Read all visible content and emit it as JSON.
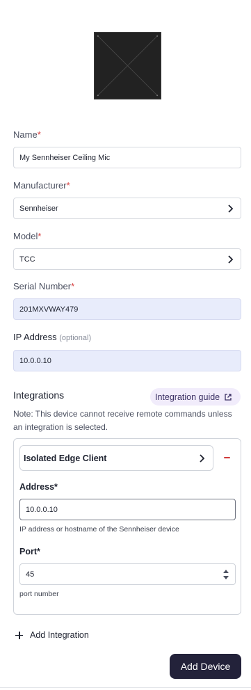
{
  "form": {
    "name": {
      "label": "Name",
      "required_mark": "*",
      "value": "My Sennheiser Ceiling Mic"
    },
    "manufacturer": {
      "label": "Manufacturer",
      "required_mark": "*",
      "value": "Sennheiser",
      "icon": "chevron-right-icon"
    },
    "model": {
      "label": "Model",
      "required_mark": "*",
      "value": "TCC",
      "icon": "chevron-right-icon"
    },
    "serial": {
      "label": "Serial Number",
      "required_mark": "*",
      "value": "201MXVWAY479"
    },
    "ip": {
      "label": "IP Address",
      "optional": "(optional)",
      "value": "10.0.0.10"
    }
  },
  "integrations": {
    "title": "Integrations",
    "guide_label": "Integration guide",
    "guide_icon": "external-link-icon",
    "note": "Note: This device cannot receive remote commands unless an integration is selected.",
    "item": {
      "selected": "Isolated Edge Client",
      "address_label": "Address*",
      "address_value": "10.0.0.10",
      "address_help": "IP address or hostname of the Sennheiser device",
      "port_label": "Port*",
      "port_value": "45",
      "port_help": "port number"
    },
    "add_label": "Add Integration"
  },
  "actions": {
    "add_device": "Add Device"
  },
  "colors": {
    "required": "#d63b3b",
    "filled_bg": "#e8ecfb",
    "guide_bg": "#f1ecfb",
    "primary_button": "#23223a",
    "remove": "#d03a3a"
  }
}
